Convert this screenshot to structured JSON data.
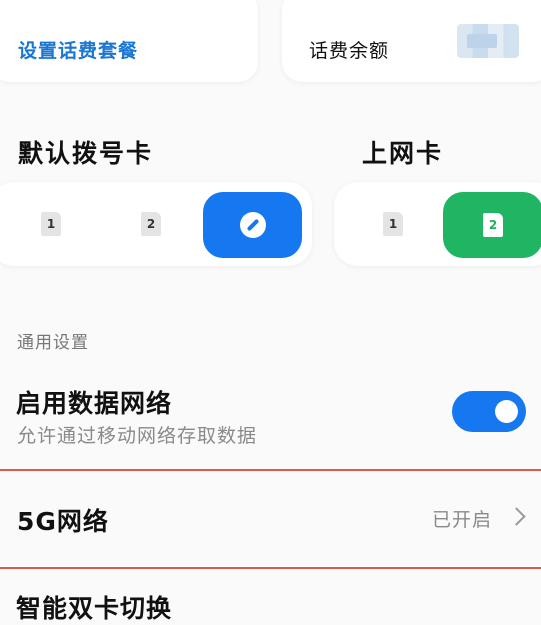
{
  "top_cards": {
    "set_plan_link": "设置话费套餐",
    "balance_label": "话费余额"
  },
  "sections": {
    "default_dial_card": "默认拨号卡",
    "data_card": "上网卡"
  },
  "dial_selector": {
    "sim1": "1",
    "sim2": "2",
    "active": "smart"
  },
  "data_selector": {
    "sim1": "1",
    "sim2": "2",
    "active": "2"
  },
  "general_settings": {
    "group_label": "通用设置",
    "enable_data_title": "启用数据网络",
    "enable_data_subtitle": "允许通过移动网络存取数据",
    "enable_data_on": true,
    "g5_title": "5G网络",
    "g5_status": "已开启",
    "smart_dual_title": "智能双卡切换"
  },
  "colors": {
    "accent_blue": "#1678f0",
    "accent_green": "#1fb563",
    "link_blue": "#1976d2",
    "divider_red": "#d85b4e"
  }
}
